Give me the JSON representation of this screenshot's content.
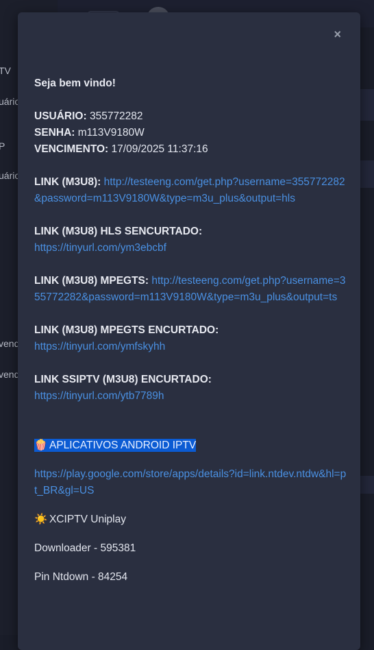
{
  "background": {
    "sidebar_items": [
      "TV",
      "uário",
      "P",
      "uário",
      "vend",
      "vend"
    ]
  },
  "modal": {
    "close_label": "×",
    "welcome": "Seja bem vindo!",
    "user_label": "USUÁRIO:",
    "user_value": "355772282",
    "pass_label": "SENHA:",
    "pass_value": "m113V9180W",
    "expiry_label": "VENCIMENTO:",
    "expiry_value": "17/09/2025 11:37:16",
    "link_m3u8_label": "LINK (M3U8):",
    "link_m3u8_url": "http://testeeng.com/get.php?username=355772282&password=m113V9180W&type=m3u_plus&output=hls",
    "link_hls_short_label": "LINK (M3U8) HLS SENCURTADO:",
    "link_hls_short_url": "https://tinyurl.com/ym3ebcbf",
    "link_mpegts_label": "LINK (M3U8) MPEGTS:",
    "link_mpegts_url": "http://testeeng.com/get.php?username=355772282&password=m113V9180W&type=m3u_plus&output=ts",
    "link_mpegts_short_label": "LINK (M3U8) MPEGTS ENCURTADO:",
    "link_mpegts_short_url": "https://tinyurl.com/ymfskyhh",
    "link_ssiptv_label": "LINK SSIPTV (M3U8) ENCURTADO:",
    "link_ssiptv_url": "https://tinyurl.com/ytb7789h",
    "apps_icon": "🍿",
    "apps_heading": "APLICATIVOS ANDROID IPTV",
    "play_store_url": "https://play.google.com/store/apps/details?id=link.ntdev.ntdw&hl=pt_BR&gl=US",
    "xciptv_icon": "☀️",
    "xciptv_text": "XCIPTV Uniplay",
    "downloader_text": "Downloader - 595381",
    "pin_text": "Pin Ntdown - 84254"
  }
}
